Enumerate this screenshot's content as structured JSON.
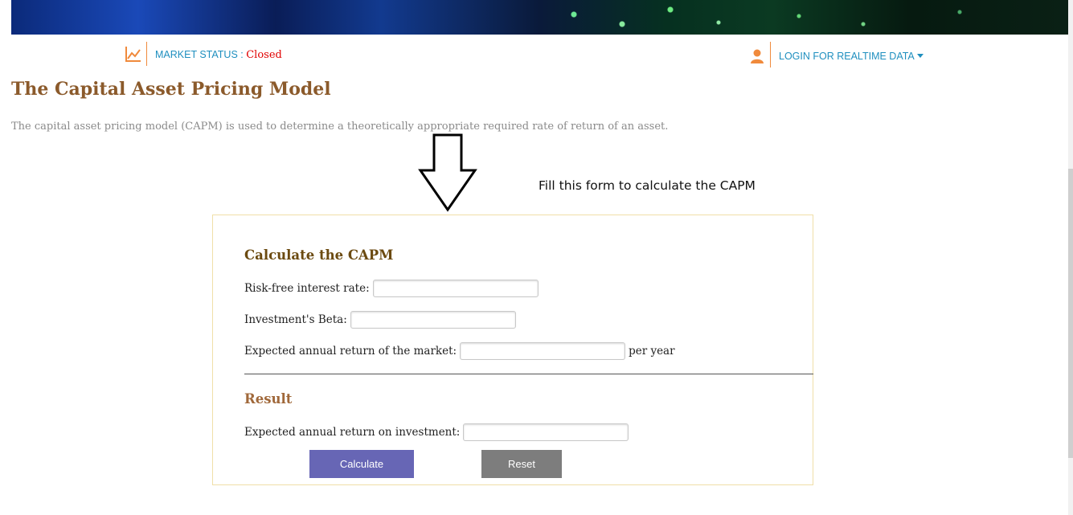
{
  "header": {
    "market_status_label": "MARKET STATUS : ",
    "market_status_value": "Closed",
    "login_label": "LOGIN FOR REALTIME DATA"
  },
  "page": {
    "title": "The Capital Asset Pricing Model",
    "intro": "The capital asset pricing model (CAPM) is used to determine a theoretically appropriate required rate of return of an asset."
  },
  "annotation": {
    "hint": "Fill this form to calculate the CAPM"
  },
  "form": {
    "heading": "Calculate the CAPM",
    "fields": [
      {
        "label": "Risk-free interest rate:",
        "value": "",
        "suffix": ""
      },
      {
        "label": "Investment's Beta:",
        "value": "",
        "suffix": ""
      },
      {
        "label": "Expected annual return of the market:",
        "value": "",
        "suffix": "per year"
      }
    ]
  },
  "result": {
    "heading": "Result",
    "label": "Expected annual return on investment:",
    "value": ""
  },
  "buttons": {
    "calculate": "Calculate",
    "reset": "Reset"
  },
  "colors": {
    "title": "#8b5a2b",
    "link": "#1f8fbf",
    "status_closed": "#e00000",
    "accent_orange": "#f08a3c",
    "calculate_button": "#6766b5",
    "reset_button": "#7d7d7d"
  }
}
